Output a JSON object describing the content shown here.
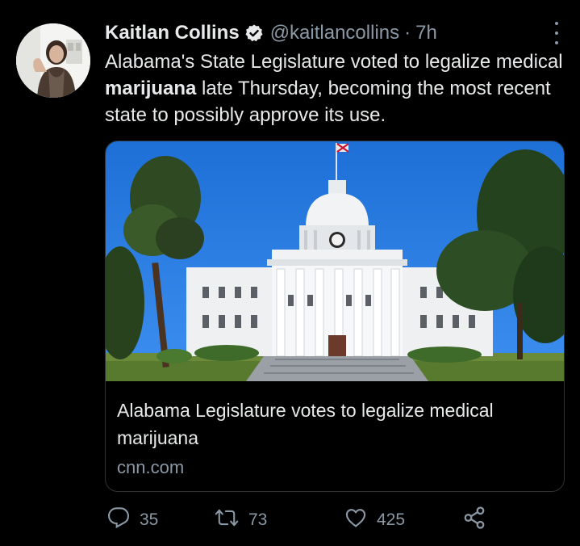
{
  "tweet": {
    "author_name": "Kaitlan Collins",
    "handle": "@kaitlancollins",
    "separator": "·",
    "time": "7h",
    "text_before": "Alabama's State Legislature voted to legalize medical ",
    "text_bold": "marijuana",
    "text_after": " late Thursday, becoming the most recent state to possibly approve its use."
  },
  "card": {
    "title": "Alabama Legislature votes to legalize medical marijuana",
    "domain": "cnn.com"
  },
  "actions": {
    "replies": "35",
    "retweets": "73",
    "likes": "425"
  },
  "colors": {
    "background": "#000000",
    "text": "#e7e9ea",
    "muted": "#8b98a5",
    "verified": "#e7e9ea"
  },
  "icons": {
    "verified": "verified-badge-icon",
    "more": "more-vertical-icon",
    "reply": "reply-icon",
    "retweet": "retweet-icon",
    "like": "heart-icon",
    "share": "share-icon"
  }
}
